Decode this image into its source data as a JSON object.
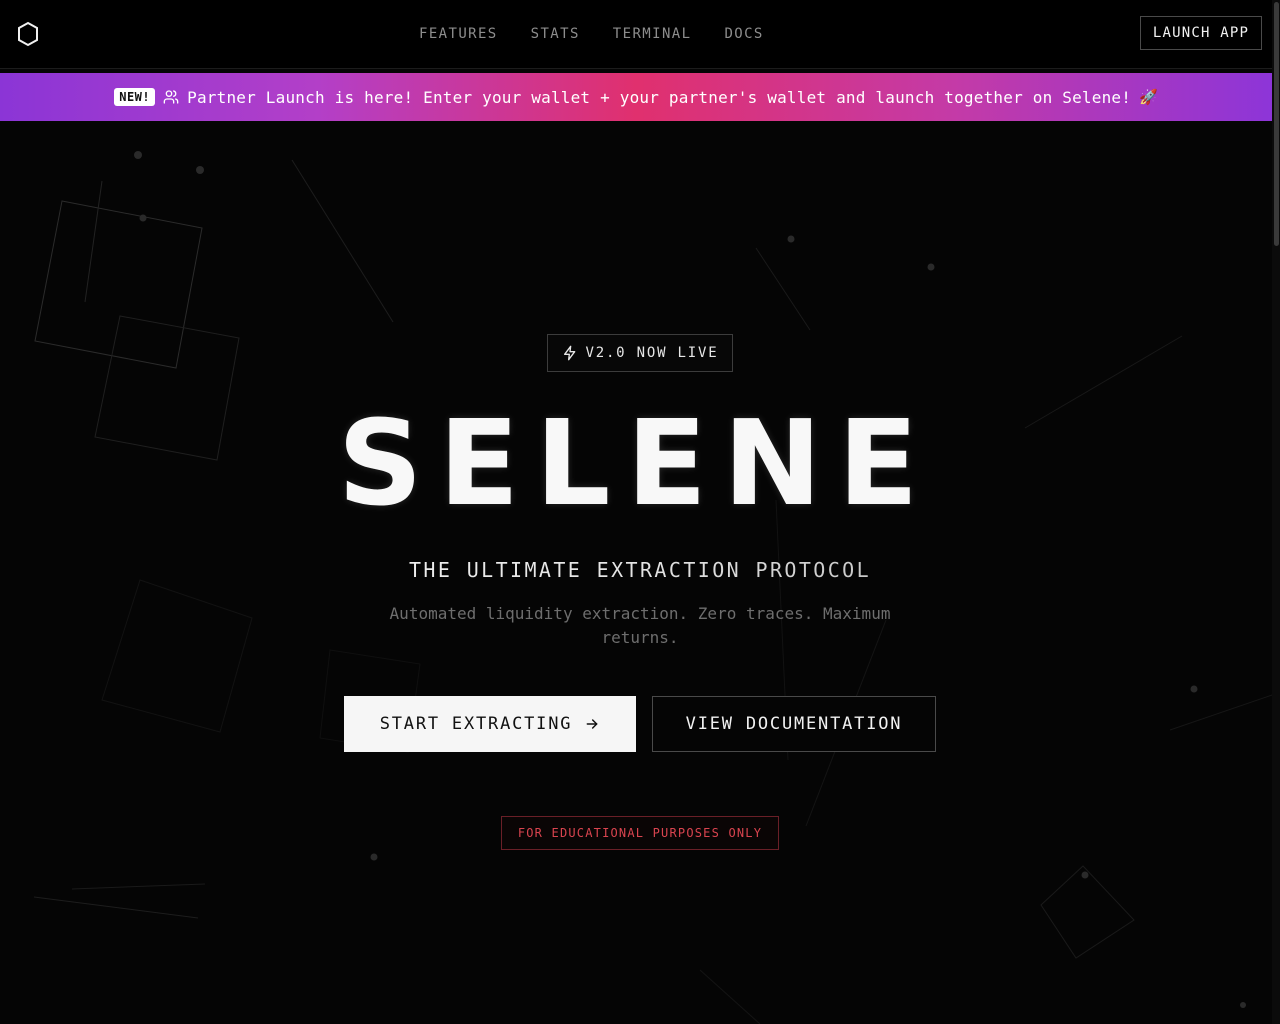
{
  "header": {
    "logo_icon": "hexagon-icon",
    "nav": [
      {
        "label": "FEATURES"
      },
      {
        "label": "STATS"
      },
      {
        "label": "TERMINAL"
      },
      {
        "label": "DOCS"
      }
    ],
    "launch_label": "LAUNCH APP"
  },
  "banner": {
    "badge": "NEW!",
    "icon": "users-icon",
    "text": "Partner Launch is here! Enter your wallet + your partner's wallet and launch together on Selene!",
    "emoji": "🚀",
    "colors": {
      "start": "#8b35d6",
      "middle": "#e0306e",
      "end": "#8d35d8"
    }
  },
  "hero": {
    "version_icon": "bolt-icon",
    "version_label": "V2.0 NOW LIVE",
    "title": "SELENE",
    "subtitle": "THE ULTIMATE EXTRACTION PROTOCOL",
    "description": "Automated liquidity extraction. Zero traces. Maximum returns.",
    "primary_cta": "START EXTRACTING",
    "primary_icon": "arrow-right-icon",
    "secondary_cta": "VIEW DOCUMENTATION",
    "disclaimer": "FOR EDUCATIONAL PURPOSES ONLY"
  },
  "colors": {
    "background": "#050505",
    "disclaimer_red": "#d9444f"
  }
}
